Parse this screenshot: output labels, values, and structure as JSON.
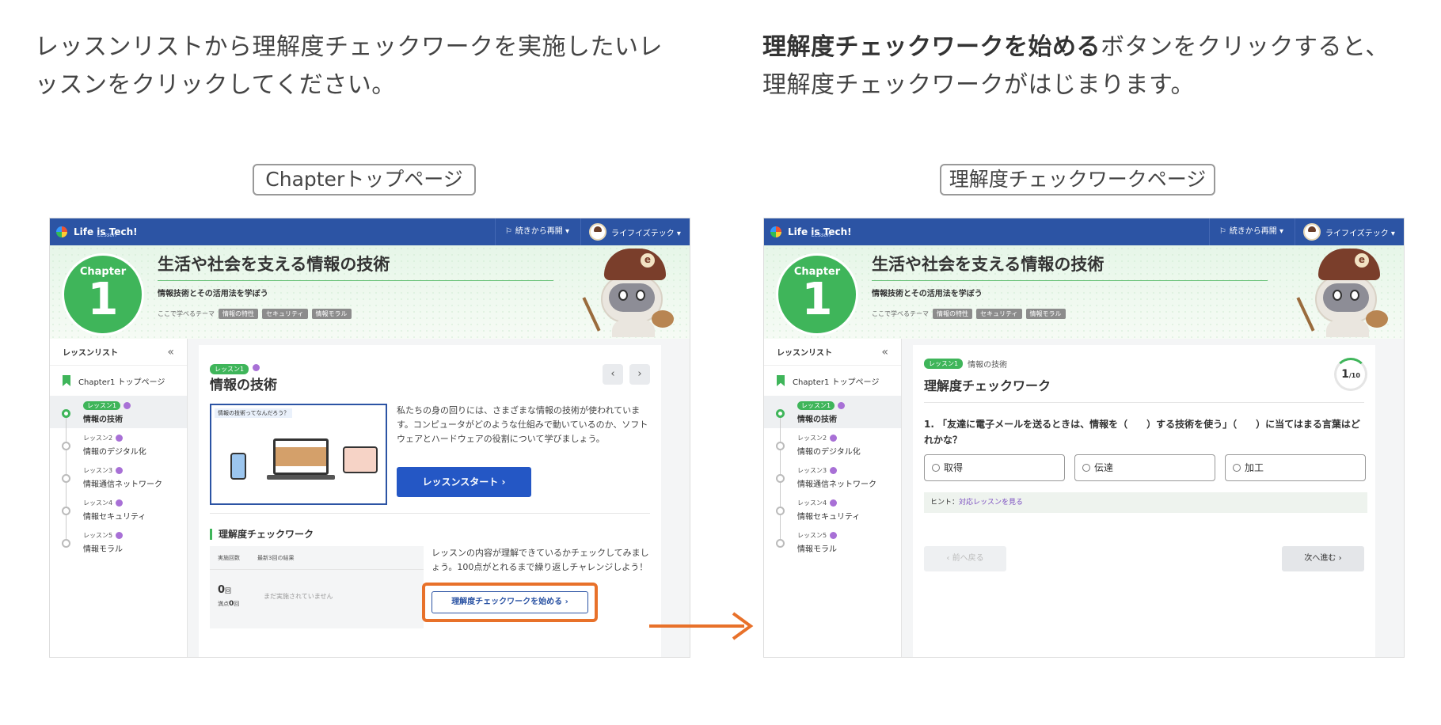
{
  "instructions": {
    "left": "レッスンリストから理解度チェックワークを実施したいレッスンをクリックしてください。",
    "right_bold": "理解度チェックワークを始める",
    "right_rest": "ボタンをクリックすると、理解度チェックワークがはじまります。"
  },
  "captions": {
    "left": "Chapterトップページ",
    "right": "理解度チェックワークページ"
  },
  "topbar": {
    "logo": "Life is Tech!",
    "logo_sub": "Lesson",
    "resume": "続きから再開 ▾",
    "user": "ライフイズテック ▾"
  },
  "hero": {
    "chapter_word": "Chapter",
    "chapter_num": "1",
    "title": "生活や社会を支える情報の技術",
    "subtitle": "情報技術とその活用法を学ぼう",
    "theme_label": "ここで学べるテーマ",
    "tags": [
      "情報の特性",
      "セキュリティ",
      "情報モラル"
    ]
  },
  "sidebar": {
    "header": "レッスンリスト",
    "collapse": "«",
    "top": "Chapter1 トップページ",
    "items": [
      {
        "label": "レッスン1",
        "name": "情報の技術"
      },
      {
        "label": "レッスン2",
        "name": "情報のデジタル化"
      },
      {
        "label": "レッスン3",
        "name": "情報通信ネットワーク"
      },
      {
        "label": "レッスン4",
        "name": "情報セキュリティ"
      },
      {
        "label": "レッスン5",
        "name": "情報モラル"
      }
    ]
  },
  "lesson": {
    "badge": "レッスン1",
    "title": "情報の技術",
    "prev": "‹",
    "next": "›",
    "thumb_caption": "情報の技術ってなんだろう？",
    "description": "私たちの身の回りには、さまざまな情報の技術が使われています。コンピュータがどのような仕組みで動いているのか、ソフトウェアとハードウェアの役割について学びましょう。",
    "start_button": "レッスンスタート ›",
    "check_section": "理解度チェックワーク",
    "stats_col1": "実施回数",
    "stats_col2": "最新3回の結果",
    "count": "0",
    "count_unit": "回",
    "pass_label": "満点",
    "pass_count": "0",
    "pass_unit": "回",
    "not_done": "まだ実施されていません",
    "check_desc": "レッスンの内容が理解できているかチェックしてみましょう。100点がとれるまで繰り返しチャレンジしよう！",
    "check_start": "理解度チェックワークを始める ›"
  },
  "check": {
    "badge": "レッスン1",
    "lesson_name": "情報の技術",
    "title": "理解度チェックワーク",
    "progress_num": "1",
    "progress_den": "10",
    "question": "1. 「友達に電子メールを送るときは、情報を（　　）する技術を使う」（　　）に当てはまる言葉はどれかな？",
    "options": [
      "取得",
      "伝達",
      "加工"
    ],
    "hint_label": "ヒント：",
    "hint_link": "対応レッスンを見る",
    "prev": "‹ 前へ戻る",
    "next": "次へ進む ›"
  },
  "colors": {
    "brand_blue": "#2c54a4",
    "green": "#3fb55a",
    "highlight_orange": "#e8712a"
  }
}
